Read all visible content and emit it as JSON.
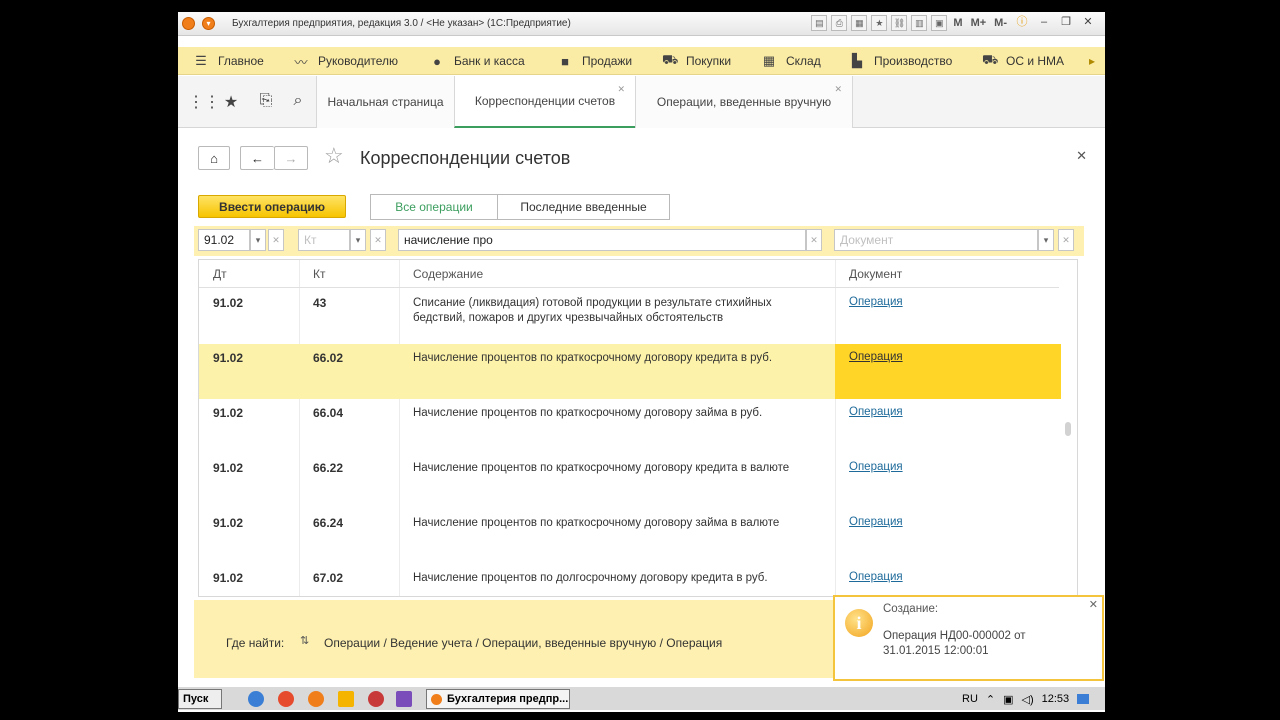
{
  "window": {
    "title": "Бухгалтерия предприятия, редакция 3.0 / <Не указан> (1С:Предприятие)",
    "tools": [
      "M",
      "M+",
      "M-"
    ]
  },
  "sections": [
    {
      "label": "Главное",
      "icon": "menu-icon"
    },
    {
      "label": "Руководителю",
      "icon": "trend-icon"
    },
    {
      "label": "Банк и касса",
      "icon": "coin-icon"
    },
    {
      "label": "Продажи",
      "icon": "bag-icon"
    },
    {
      "label": "Покупки",
      "icon": "cart-icon"
    },
    {
      "label": "Склад",
      "icon": "warehouse-icon"
    },
    {
      "label": "Производство",
      "icon": "factory-icon"
    },
    {
      "label": "ОС и НМА",
      "icon": "truck-icon"
    }
  ],
  "tabs": [
    {
      "label": "Начальная страница"
    },
    {
      "label": "Корреспонденции счетов",
      "active": true
    },
    {
      "label": "Операции, введенные вручную"
    }
  ],
  "form": {
    "title": "Корреспонденции счетов",
    "primary_button": "Ввести операцию",
    "segments": [
      "Все операции",
      "Последние введенные"
    ],
    "active_segment": "Все операции"
  },
  "filters": {
    "dt_value": "91.02",
    "kt_placeholder": "Кт",
    "content_value": "начисление про",
    "doc_placeholder": "Документ"
  },
  "table": {
    "columns": [
      "Дт",
      "Кт",
      "Содержание",
      "Документ"
    ],
    "rows": [
      {
        "dt": "91.02",
        "kt": "43",
        "content": "Списание (ликвидация) готовой продукции в результате стихийных бедствий, пожаров и других чрезвычайных обстоятельств",
        "doc": "Операция"
      },
      {
        "dt": "91.02",
        "kt": "66.02",
        "content": "Начисление процентов по краткосрочному договору кредита в руб.",
        "doc": "Операция",
        "selected": true
      },
      {
        "dt": "91.02",
        "kt": "66.04",
        "content": "Начисление процентов по краткосрочному договору займа в руб.",
        "doc": "Операция"
      },
      {
        "dt": "91.02",
        "kt": "66.22",
        "content": "Начисление процентов по краткосрочному договору кредита в валюте",
        "doc": "Операция"
      },
      {
        "dt": "91.02",
        "kt": "66.24",
        "content": "Начисление процентов по краткосрочному договору займа в валюте",
        "doc": "Операция"
      },
      {
        "dt": "91.02",
        "kt": "67.02",
        "content": "Начисление процентов по долгосрочному договору кредита в руб.",
        "doc": "Операция"
      }
    ]
  },
  "where_to_find": {
    "label": "Где найти:",
    "path": "Операции / Ведение учета / Операции, введенные вручную / Операция"
  },
  "notification": {
    "header": "Создание:",
    "body": "Операция НД00-000002 от 31.01.2015 12:00:01"
  },
  "taskbar": {
    "start": "Пуск",
    "task": "Бухгалтерия предпр...",
    "lang": "RU",
    "time": "12:53"
  }
}
